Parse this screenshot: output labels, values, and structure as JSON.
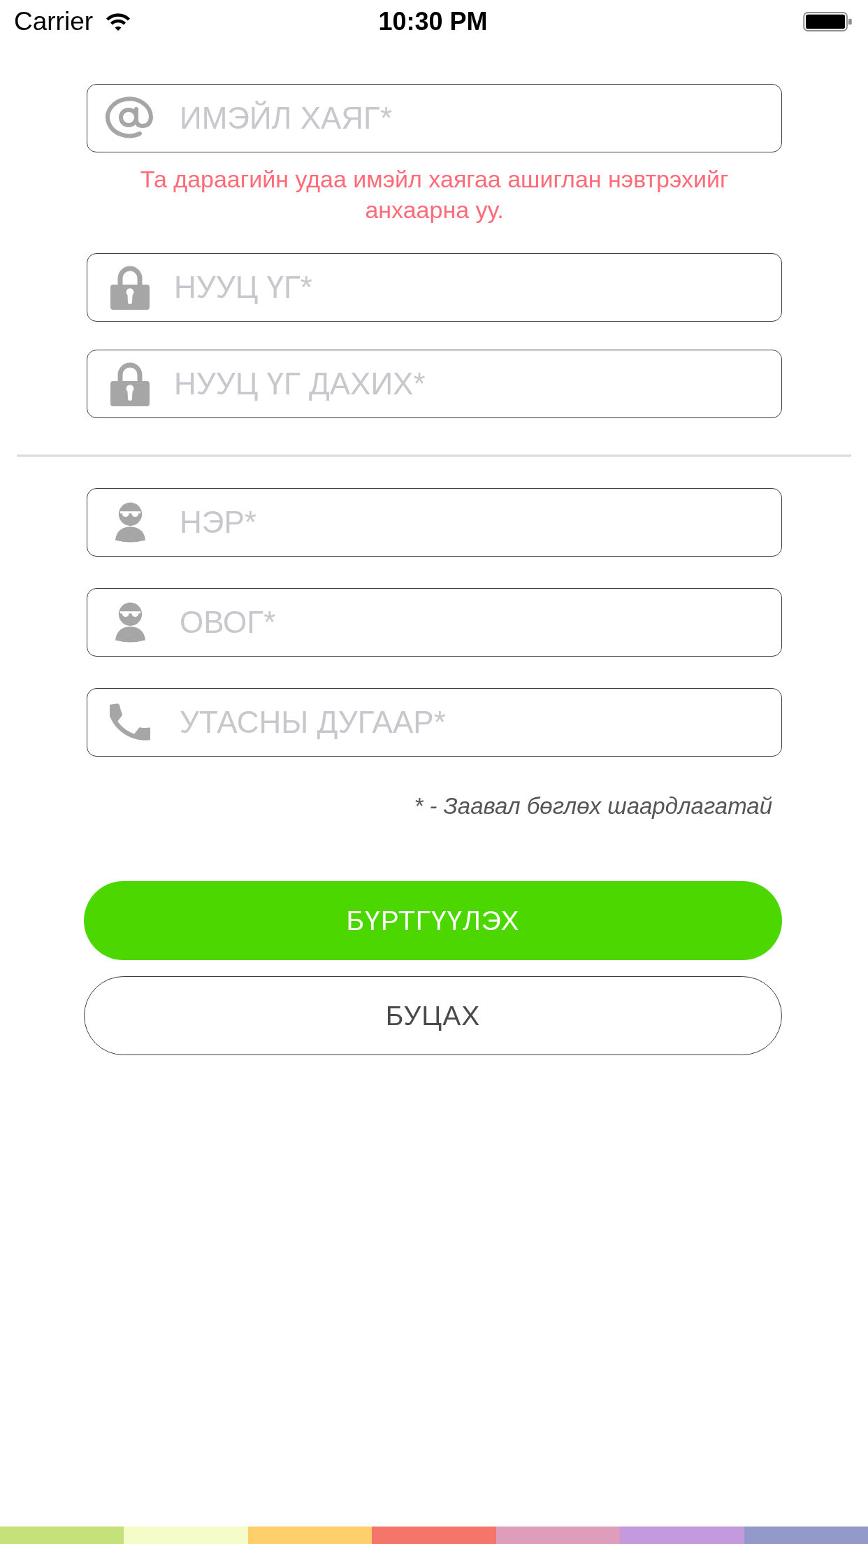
{
  "status_bar": {
    "carrier": "Carrier",
    "time": "10:30 PM"
  },
  "account_fields": [
    {
      "kind": "email",
      "placeholder": "ИМЭЙЛ ХАЯГ*",
      "note": "Та дараагийн удаа имэйл хаягаа ашиглан нэвтрэхийг анхаарна уу."
    },
    {
      "kind": "password",
      "placeholder": "НУУЦ ҮГ*"
    },
    {
      "kind": "password",
      "placeholder": "НУУЦ ҮГ ДАХИХ*"
    }
  ],
  "profile_fields": [
    {
      "kind": "person",
      "placeholder": "НЭР*"
    },
    {
      "kind": "person",
      "placeholder": "ОВОГ*"
    },
    {
      "kind": "phone",
      "placeholder": "УТАСНЫ ДУГААР*"
    }
  ],
  "required_note": "* - Заавал бөглөх шаардлагатай",
  "buttons": [
    {
      "kind": "primary",
      "label": "БҮРТГҮҮЛЭХ"
    },
    {
      "kind": "secondary",
      "label": "БУЦАХ"
    }
  ]
}
